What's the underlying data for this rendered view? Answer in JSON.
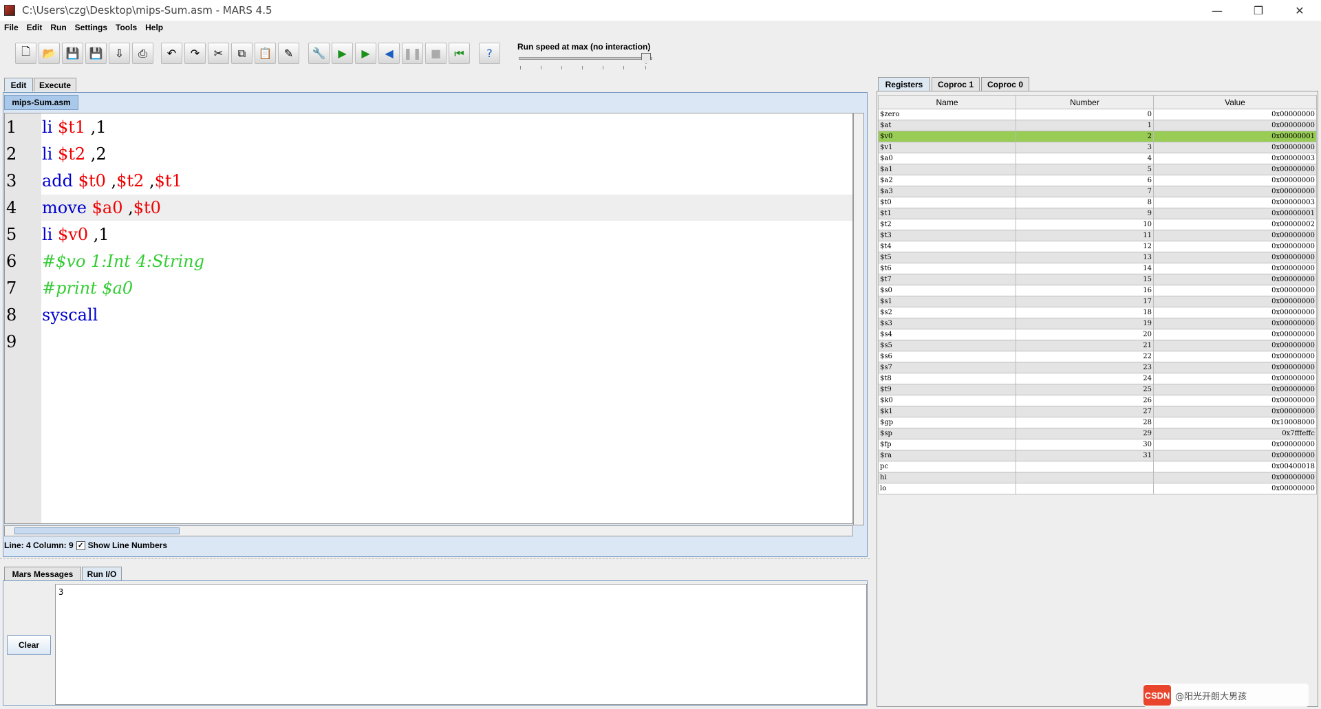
{
  "window": {
    "title": "C:\\Users\\czg\\Desktop\\mips-Sum.asm  - MARS 4.5"
  },
  "menu": [
    "File",
    "Edit",
    "Run",
    "Settings",
    "Tools",
    "Help"
  ],
  "toolbar": {
    "speed_label": "Run speed at max (no interaction)"
  },
  "tabs": {
    "edit": "Edit",
    "execute": "Execute",
    "file": "mips-Sum.asm"
  },
  "code": [
    {
      "num": "1",
      "parts": [
        [
          "kw",
          "li "
        ],
        [
          "reg",
          "$t1"
        ],
        [
          "num",
          " ,1"
        ]
      ]
    },
    {
      "num": "2",
      "parts": [
        [
          "kw",
          "li "
        ],
        [
          "reg",
          "$t2"
        ],
        [
          "num",
          " ,2"
        ]
      ]
    },
    {
      "num": "3",
      "parts": [
        [
          "kw",
          "add "
        ],
        [
          "reg",
          "$t0"
        ],
        [
          "num",
          " ,"
        ],
        [
          "reg",
          "$t2"
        ],
        [
          "num",
          " ,"
        ],
        [
          "reg",
          "$t1"
        ]
      ]
    },
    {
      "num": "4",
      "parts": [
        [
          "kw",
          "move "
        ],
        [
          "reg",
          "$a0"
        ],
        [
          "num",
          " ,"
        ],
        [
          "reg",
          "$t0"
        ]
      ]
    },
    {
      "num": "5",
      "parts": [
        [
          "kw",
          "li "
        ],
        [
          "reg",
          "$v0"
        ],
        [
          "num",
          " ,1"
        ]
      ]
    },
    {
      "num": "6",
      "parts": [
        [
          "cmt",
          "#$vo 1:Int 4:String"
        ]
      ]
    },
    {
      "num": "7",
      "parts": [
        [
          "cmt",
          "#print $a0"
        ]
      ]
    },
    {
      "num": "8",
      "parts": [
        [
          "kw",
          "syscall"
        ]
      ]
    },
    {
      "num": "9",
      "parts": []
    }
  ],
  "status": {
    "position": "Line: 4 Column: 9",
    "show_line_numbers": "Show Line Numbers"
  },
  "messages": {
    "tab_messages": "Mars Messages",
    "tab_runio": "Run I/O",
    "clear": "Clear",
    "output": "3"
  },
  "registers": {
    "tabs": [
      "Registers",
      "Coproc 1",
      "Coproc 0"
    ],
    "columns": [
      "Name",
      "Number",
      "Value"
    ],
    "rows": [
      [
        "$zero",
        "0",
        "0x00000000"
      ],
      [
        "$at",
        "1",
        "0x00000000"
      ],
      [
        "$v0",
        "2",
        "0x00000001"
      ],
      [
        "$v1",
        "3",
        "0x00000000"
      ],
      [
        "$a0",
        "4",
        "0x00000003"
      ],
      [
        "$a1",
        "5",
        "0x00000000"
      ],
      [
        "$a2",
        "6",
        "0x00000000"
      ],
      [
        "$a3",
        "7",
        "0x00000000"
      ],
      [
        "$t0",
        "8",
        "0x00000003"
      ],
      [
        "$t1",
        "9",
        "0x00000001"
      ],
      [
        "$t2",
        "10",
        "0x00000002"
      ],
      [
        "$t3",
        "11",
        "0x00000000"
      ],
      [
        "$t4",
        "12",
        "0x00000000"
      ],
      [
        "$t5",
        "13",
        "0x00000000"
      ],
      [
        "$t6",
        "14",
        "0x00000000"
      ],
      [
        "$t7",
        "15",
        "0x00000000"
      ],
      [
        "$s0",
        "16",
        "0x00000000"
      ],
      [
        "$s1",
        "17",
        "0x00000000"
      ],
      [
        "$s2",
        "18",
        "0x00000000"
      ],
      [
        "$s3",
        "19",
        "0x00000000"
      ],
      [
        "$s4",
        "20",
        "0x00000000"
      ],
      [
        "$s5",
        "21",
        "0x00000000"
      ],
      [
        "$s6",
        "22",
        "0x00000000"
      ],
      [
        "$s7",
        "23",
        "0x00000000"
      ],
      [
        "$t8",
        "24",
        "0x00000000"
      ],
      [
        "$t9",
        "25",
        "0x00000000"
      ],
      [
        "$k0",
        "26",
        "0x00000000"
      ],
      [
        "$k1",
        "27",
        "0x00000000"
      ],
      [
        "$gp",
        "28",
        "0x10008000"
      ],
      [
        "$sp",
        "29",
        "0x7fffeffc"
      ],
      [
        "$fp",
        "30",
        "0x00000000"
      ],
      [
        "$ra",
        "31",
        "0x00000000"
      ],
      [
        "pc",
        "",
        "0x00400018"
      ],
      [
        "hi",
        "",
        "0x00000000"
      ],
      [
        "lo",
        "",
        "0x00000000"
      ]
    ],
    "highlight_row": 2
  },
  "watermark": {
    "logo": "CSDN",
    "text": "@阳光开朗大男孩"
  }
}
